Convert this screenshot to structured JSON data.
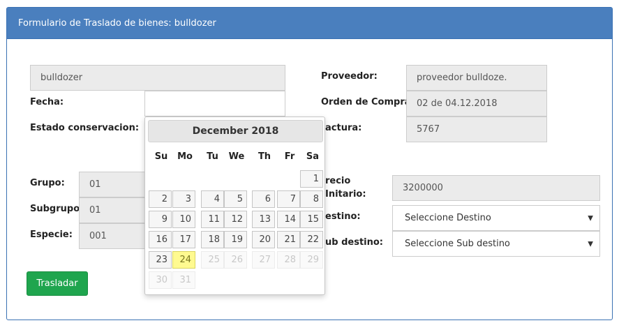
{
  "panel": {
    "title": "Formulario de Traslado de bienes: bulldozer"
  },
  "form": {
    "nombre_value": "bulldozer",
    "fecha_label": "Fecha:",
    "fecha_value": "",
    "estado_label": "Estado conservacion:",
    "grupo_label": "Grupo:",
    "grupo_value": "01",
    "subgrupo_label": "Subgrupo:",
    "subgrupo_value": "01",
    "especie_label": "Especie:",
    "especie_value": "001",
    "proveedor_label": "Proveedor:",
    "proveedor_value": "proveedor bulldoze.",
    "orden_label": "Orden de Compra:",
    "orden_value": "02 de 04.12.2018",
    "factura_label": "actura:",
    "factura_value": "5767",
    "precio_label_1": "recio",
    "precio_label_2": "Initario:",
    "precio_value": "3200000",
    "destino_label": "estino:",
    "destino_value": "Seleccione Destino",
    "subdestino_label": "ub destino:",
    "subdestino_value": "Seleccione Sub destino",
    "submit_label": "Trasladar"
  },
  "datepicker": {
    "title": "December 2018",
    "weekdays": [
      "Su",
      "Mo",
      "Tu",
      "We",
      "Th",
      "Fr",
      "Sa"
    ],
    "weeks": [
      [
        null,
        null,
        null,
        null,
        null,
        null,
        "1"
      ],
      [
        "2",
        "3",
        "4",
        "5",
        "6",
        "7",
        "8"
      ],
      [
        "9",
        "10",
        "11",
        "12",
        "13",
        "14",
        "15"
      ],
      [
        "16",
        "17",
        "18",
        "19",
        "20",
        "21",
        "22"
      ],
      [
        "23",
        "24",
        "25",
        "26",
        "27",
        "28",
        "29"
      ],
      [
        "30",
        "31",
        null,
        null,
        null,
        null,
        null
      ]
    ],
    "today": "24",
    "disabled_after": "24"
  }
}
